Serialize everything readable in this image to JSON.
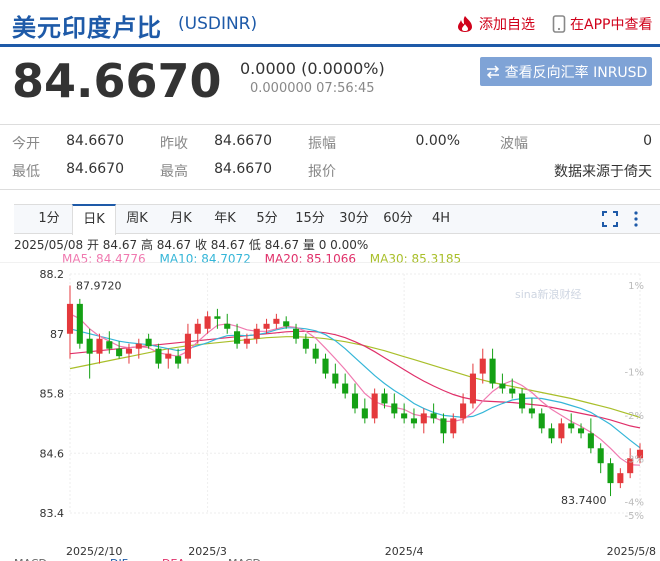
{
  "header": {
    "title": "美元印度卢比",
    "code": "(USDINR)",
    "add_watch": "添加自选",
    "view_in_app": "在APP中查看"
  },
  "quote": {
    "price": "84.6670",
    "change": "0.0000 (0.0000%)",
    "sub": "0.000000 07:56:45",
    "reverse_button": "查看反向汇率 INRUSD"
  },
  "stats": {
    "open_label": "今开",
    "open": "84.6670",
    "prev_label": "昨收",
    "prev": "84.6670",
    "amp_label": "振幅",
    "amp": "0.00%",
    "wave_label": "波幅",
    "wave": "0",
    "low_label": "最低",
    "low": "84.6670",
    "high_label": "最高",
    "high": "84.6670",
    "quote_label": "报价",
    "source": "数据来源于倚天"
  },
  "tabs": [
    "1分",
    "日K",
    "周K",
    "月K",
    "年K",
    "5分",
    "15分",
    "30分",
    "60分",
    "4H"
  ],
  "active_tab": "日K",
  "ohlc_line": "2025/05/08 开 84.67 高 84.67 收 84.67 低 84.67 量 0 0.00%",
  "ma_legend": {
    "ma5": "MA5: 84.4776",
    "ma10": "MA10: 84.7072",
    "ma20": "MA20: 85.1066",
    "ma30": "MA30: 85.3185"
  },
  "colors": {
    "brand": "#1e5aa8",
    "up": "#e4393c",
    "down": "#14a014",
    "ma5": "#f07ab0",
    "ma10": "#35b6d8",
    "ma20": "#e0306a",
    "ma30": "#a9bf2a"
  },
  "chart_data": {
    "type": "candlestick",
    "ylim": [
      83.4,
      88.2
    ],
    "y_ticks": [
      "88.2",
      "87",
      "85.8",
      "84.6",
      "83.4"
    ],
    "y_tick_values": [
      88.2,
      87,
      85.8,
      84.6,
      83.4
    ],
    "pct_ticks": [
      "1%",
      "-1%",
      "-2%",
      "-3%",
      "-4%",
      "-5%"
    ],
    "pct_tick_values": [
      1,
      -1,
      -2,
      -3,
      -4,
      -5
    ],
    "pct_base": 87.03,
    "x_labels": [
      "2025/2/10",
      "2025/3",
      "2025/4",
      "2025/5/8"
    ],
    "x_label_index": [
      0,
      14,
      34,
      58
    ],
    "max_label": "87.9720",
    "min_label": "83.7400",
    "watermark": "sina新浪财经",
    "bottom_labels": [
      "MACD",
      "DIF",
      "DEA",
      "MACD"
    ],
    "candles": [
      {
        "o": 87.0,
        "h": 87.97,
        "l": 86.5,
        "c": 87.6
      },
      {
        "o": 87.6,
        "h": 87.7,
        "l": 86.7,
        "c": 86.8
      },
      {
        "o": 86.9,
        "h": 87.1,
        "l": 86.1,
        "c": 86.6
      },
      {
        "o": 86.6,
        "h": 87.0,
        "l": 86.4,
        "c": 86.9
      },
      {
        "o": 86.85,
        "h": 87.05,
        "l": 86.6,
        "c": 86.7
      },
      {
        "o": 86.7,
        "h": 86.85,
        "l": 86.5,
        "c": 86.55
      },
      {
        "o": 86.6,
        "h": 86.8,
        "l": 86.4,
        "c": 86.7
      },
      {
        "o": 86.7,
        "h": 86.9,
        "l": 86.5,
        "c": 86.8
      },
      {
        "o": 86.9,
        "h": 87.0,
        "l": 86.7,
        "c": 86.75
      },
      {
        "o": 86.7,
        "h": 86.8,
        "l": 86.3,
        "c": 86.4
      },
      {
        "o": 86.5,
        "h": 86.7,
        "l": 86.3,
        "c": 86.6
      },
      {
        "o": 86.55,
        "h": 86.7,
        "l": 86.3,
        "c": 86.4
      },
      {
        "o": 86.5,
        "h": 87.2,
        "l": 86.4,
        "c": 87.0
      },
      {
        "o": 87.0,
        "h": 87.3,
        "l": 86.8,
        "c": 87.2
      },
      {
        "o": 87.1,
        "h": 87.45,
        "l": 87.0,
        "c": 87.35
      },
      {
        "o": 87.35,
        "h": 87.5,
        "l": 87.1,
        "c": 87.3
      },
      {
        "o": 87.2,
        "h": 87.4,
        "l": 87.0,
        "c": 87.1
      },
      {
        "o": 87.05,
        "h": 87.2,
        "l": 86.7,
        "c": 86.8
      },
      {
        "o": 86.8,
        "h": 87.0,
        "l": 86.7,
        "c": 86.9
      },
      {
        "o": 86.9,
        "h": 87.2,
        "l": 86.8,
        "c": 87.1
      },
      {
        "o": 87.1,
        "h": 87.3,
        "l": 87.0,
        "c": 87.2
      },
      {
        "o": 87.2,
        "h": 87.4,
        "l": 87.1,
        "c": 87.3
      },
      {
        "o": 87.25,
        "h": 87.35,
        "l": 87.1,
        "c": 87.15
      },
      {
        "o": 87.1,
        "h": 87.2,
        "l": 86.8,
        "c": 86.9
      },
      {
        "o": 86.9,
        "h": 87.0,
        "l": 86.6,
        "c": 86.7
      },
      {
        "o": 86.7,
        "h": 86.8,
        "l": 86.4,
        "c": 86.5
      },
      {
        "o": 86.5,
        "h": 86.6,
        "l": 86.1,
        "c": 86.2
      },
      {
        "o": 86.2,
        "h": 86.4,
        "l": 85.9,
        "c": 86.0
      },
      {
        "o": 86.0,
        "h": 86.2,
        "l": 85.7,
        "c": 85.8
      },
      {
        "o": 85.8,
        "h": 86.0,
        "l": 85.4,
        "c": 85.5
      },
      {
        "o": 85.5,
        "h": 85.7,
        "l": 85.2,
        "c": 85.3
      },
      {
        "o": 85.3,
        "h": 85.9,
        "l": 85.2,
        "c": 85.8
      },
      {
        "o": 85.8,
        "h": 85.9,
        "l": 85.5,
        "c": 85.6
      },
      {
        "o": 85.6,
        "h": 85.8,
        "l": 85.3,
        "c": 85.4
      },
      {
        "o": 85.4,
        "h": 85.6,
        "l": 85.2,
        "c": 85.3
      },
      {
        "o": 85.3,
        "h": 85.5,
        "l": 85.1,
        "c": 85.2
      },
      {
        "o": 85.2,
        "h": 85.5,
        "l": 85.0,
        "c": 85.4
      },
      {
        "o": 85.4,
        "h": 85.6,
        "l": 85.2,
        "c": 85.3
      },
      {
        "o": 85.3,
        "h": 85.4,
        "l": 84.8,
        "c": 85.0
      },
      {
        "o": 85.0,
        "h": 85.4,
        "l": 84.9,
        "c": 85.3
      },
      {
        "o": 85.3,
        "h": 85.8,
        "l": 85.2,
        "c": 85.6
      },
      {
        "o": 85.6,
        "h": 86.4,
        "l": 85.5,
        "c": 86.2
      },
      {
        "o": 86.2,
        "h": 86.7,
        "l": 86.0,
        "c": 86.5
      },
      {
        "o": 86.5,
        "h": 86.7,
        "l": 85.9,
        "c": 86.0
      },
      {
        "o": 86.0,
        "h": 86.2,
        "l": 85.8,
        "c": 85.9
      },
      {
        "o": 85.9,
        "h": 86.1,
        "l": 85.7,
        "c": 85.8
      },
      {
        "o": 85.8,
        "h": 85.9,
        "l": 85.4,
        "c": 85.5
      },
      {
        "o": 85.5,
        "h": 85.7,
        "l": 85.3,
        "c": 85.4
      },
      {
        "o": 85.4,
        "h": 85.5,
        "l": 85.0,
        "c": 85.1
      },
      {
        "o": 85.1,
        "h": 85.2,
        "l": 84.8,
        "c": 84.9
      },
      {
        "o": 84.9,
        "h": 85.3,
        "l": 84.8,
        "c": 85.2
      },
      {
        "o": 85.2,
        "h": 85.4,
        "l": 85.0,
        "c": 85.1
      },
      {
        "o": 85.1,
        "h": 85.2,
        "l": 84.9,
        "c": 85.0
      },
      {
        "o": 85.0,
        "h": 85.3,
        "l": 84.6,
        "c": 84.7
      },
      {
        "o": 84.7,
        "h": 84.8,
        "l": 84.2,
        "c": 84.4
      },
      {
        "o": 84.4,
        "h": 84.5,
        "l": 83.74,
        "c": 84.0
      },
      {
        "o": 84.0,
        "h": 84.3,
        "l": 83.9,
        "c": 84.2
      },
      {
        "o": 84.2,
        "h": 84.7,
        "l": 84.1,
        "c": 84.5
      },
      {
        "o": 84.5,
        "h": 84.8,
        "l": 84.4,
        "c": 84.67
      }
    ],
    "ma5": [
      87.4,
      87.3,
      87.1,
      86.95,
      86.85,
      86.75,
      86.72,
      86.74,
      86.72,
      86.62,
      86.58,
      86.55,
      86.65,
      86.84,
      87.02,
      87.17,
      87.2,
      87.15,
      87.08,
      87.05,
      87.05,
      87.1,
      87.15,
      87.13,
      87.05,
      86.91,
      86.71,
      86.5,
      86.28,
      86.04,
      85.8,
      85.64,
      85.56,
      85.52,
      85.48,
      85.38,
      85.34,
      85.32,
      85.24,
      85.24,
      85.28,
      85.42,
      85.65,
      85.84,
      85.98,
      86.06,
      85.96,
      85.82,
      85.64,
      85.48,
      85.36,
      85.24,
      85.14,
      85.02,
      84.88,
      84.7,
      84.5,
      84.37,
      84.36
    ],
    "ma10": [
      87.1,
      87.05,
      87.0,
      86.95,
      86.9,
      86.85,
      86.82,
      86.8,
      86.78,
      86.74,
      86.7,
      86.66,
      86.7,
      86.76,
      86.82,
      86.9,
      86.96,
      86.97,
      86.96,
      86.98,
      87.02,
      87.08,
      87.12,
      87.12,
      87.1,
      87.06,
      86.98,
      86.86,
      86.7,
      86.52,
      86.34,
      86.16,
      86.0,
      85.86,
      85.74,
      85.6,
      85.5,
      85.42,
      85.36,
      85.34,
      85.32,
      85.34,
      85.42,
      85.52,
      85.6,
      85.67,
      85.7,
      85.71,
      85.7,
      85.66,
      85.62,
      85.56,
      85.5,
      85.42,
      85.3,
      85.18,
      85.02,
      84.86,
      84.71
    ],
    "ma20": [
      86.6,
      86.62,
      86.64,
      86.66,
      86.68,
      86.7,
      86.72,
      86.74,
      86.76,
      86.78,
      86.8,
      86.82,
      86.84,
      86.86,
      86.88,
      86.9,
      86.92,
      86.94,
      86.96,
      86.98,
      87.0,
      87.02,
      87.04,
      87.05,
      87.05,
      87.04,
      87.02,
      86.98,
      86.92,
      86.84,
      86.75,
      86.64,
      86.52,
      86.4,
      86.28,
      86.16,
      86.05,
      85.95,
      85.86,
      85.78,
      85.72,
      85.68,
      85.65,
      85.64,
      85.63,
      85.62,
      85.6,
      85.58,
      85.56,
      85.52,
      85.48,
      85.44,
      85.4,
      85.36,
      85.32,
      85.27,
      85.21,
      85.15,
      85.11
    ],
    "ma30": [
      86.3,
      86.34,
      86.38,
      86.42,
      86.46,
      86.5,
      86.54,
      86.58,
      86.62,
      86.66,
      86.7,
      86.73,
      86.76,
      86.78,
      86.8,
      86.82,
      86.84,
      86.86,
      86.88,
      86.9,
      86.92,
      86.93,
      86.94,
      86.94,
      86.93,
      86.92,
      86.9,
      86.87,
      86.84,
      86.8,
      86.76,
      86.71,
      86.66,
      86.6,
      86.54,
      86.48,
      86.42,
      86.36,
      86.3,
      86.24,
      86.18,
      86.12,
      86.07,
      86.02,
      85.98,
      85.94,
      85.9,
      85.86,
      85.82,
      85.78,
      85.74,
      85.7,
      85.65,
      85.6,
      85.55,
      85.5,
      85.44,
      85.38,
      85.32
    ]
  }
}
